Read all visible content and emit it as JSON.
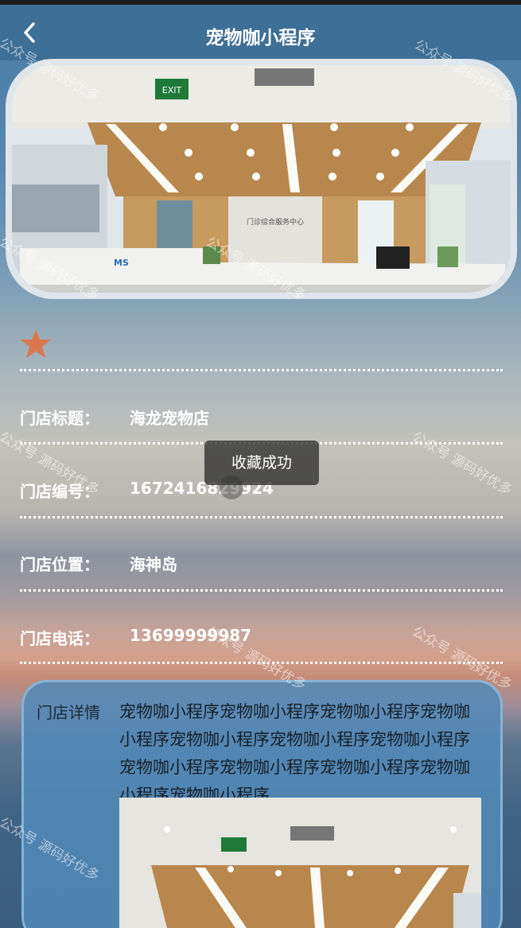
{
  "header": {
    "title": "宠物咖小程序",
    "back_icon": "chevron-left-icon"
  },
  "favorite": {
    "icon": "star-icon",
    "color": "#d9784f"
  },
  "fields": [
    {
      "label": "门店标题：",
      "value": "海龙宠物店"
    },
    {
      "label": "门店编号：",
      "value": "1672416829924"
    },
    {
      "label": "门店位置：",
      "value": "海神岛"
    },
    {
      "label": "门店电话：",
      "value": "13699999987"
    }
  ],
  "detail": {
    "label": "门店详情",
    "text": "宠物咖小程序宠物咖小程序宠物咖小程序宠物咖小程序宠物咖小程序宠物咖小程序宠物咖小程序宠物咖小程序宠物咖小程序宠物咖小程序宠物咖小程序宠物咖小程序"
  },
  "toast": {
    "text": "收藏成功"
  },
  "watermarks": [
    "公众号 源码好优多",
    "公众号 源码好优多",
    "公众号 源码好优多",
    "公众号 源码好优多",
    "公众号 源码好优多",
    "公众号 源码好优多",
    "公众号 源码好优多",
    "公众号 源码好优多",
    "公众号 源码好优多"
  ],
  "photo_sign": "门诊综合服务中心",
  "exit_sign": "EXIT"
}
